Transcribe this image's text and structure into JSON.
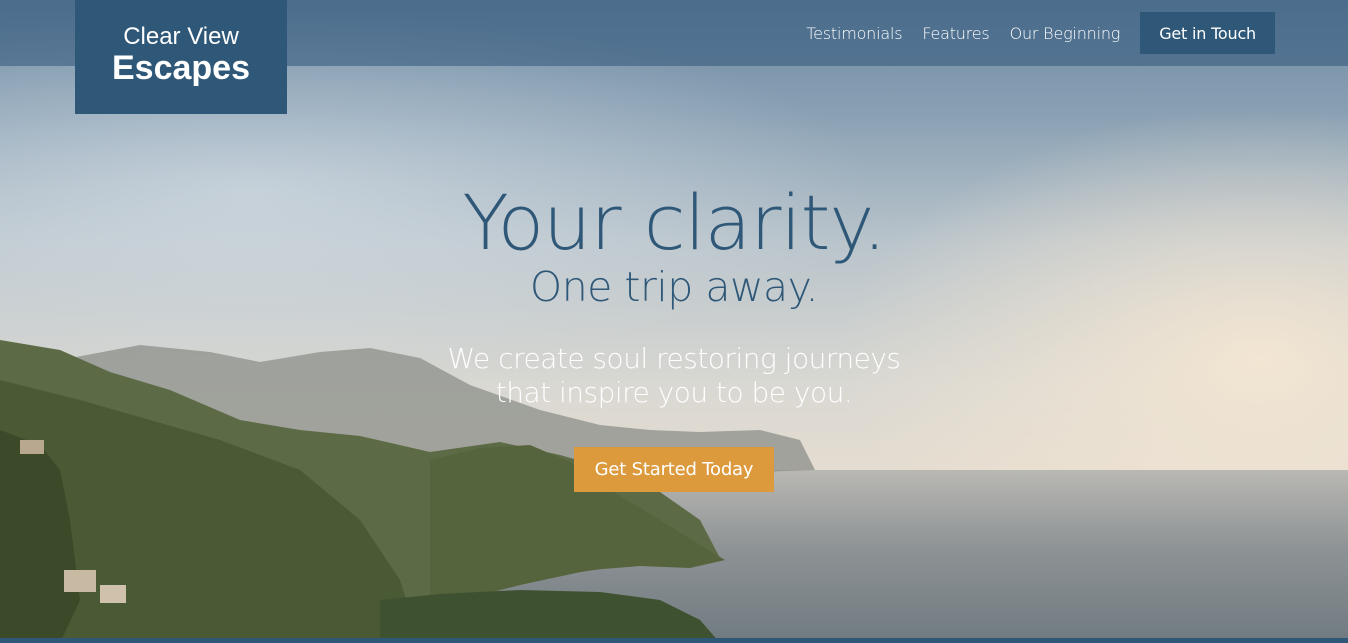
{
  "brand": {
    "line1": "Clear View",
    "line2": "Escapes"
  },
  "nav": {
    "items": [
      {
        "label": "Testimonials"
      },
      {
        "label": "Features"
      },
      {
        "label": "Our Beginning"
      }
    ],
    "cta_label": "Get in Touch"
  },
  "hero": {
    "headline": "Your clarity.",
    "subheadline": "One trip away.",
    "tagline": "We create soul restoring journeys that inspire you to be you.",
    "cta_label": "Get Started Today"
  },
  "colors": {
    "brand_blue": "#2f5878",
    "accent_orange": "#dc9a3c"
  }
}
